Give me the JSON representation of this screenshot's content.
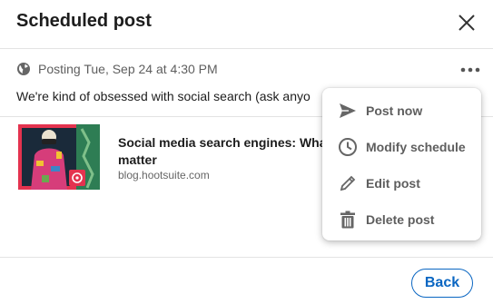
{
  "header": {
    "title": "Scheduled post"
  },
  "post": {
    "schedule_text": "Posting Tue, Sep 24 at 4:30 PM",
    "body_text": "We're kind of obsessed with social search (ask anyo",
    "link": {
      "title": "Social media search engines: Wha matter",
      "domain": "blog.hootsuite.com"
    }
  },
  "menu": {
    "items": [
      {
        "label": "Post now",
        "icon": "send-icon"
      },
      {
        "label": "Modify schedule",
        "icon": "clock-icon"
      },
      {
        "label": "Edit post",
        "icon": "pencil-icon"
      },
      {
        "label": "Delete post",
        "icon": "trash-icon"
      }
    ]
  },
  "footer": {
    "back_label": "Back"
  },
  "colors": {
    "accent": "#0a66c2",
    "muted_text": "#5e5e5e",
    "thumb_red": "#e4334f",
    "thumb_green": "#1f6b4d"
  }
}
